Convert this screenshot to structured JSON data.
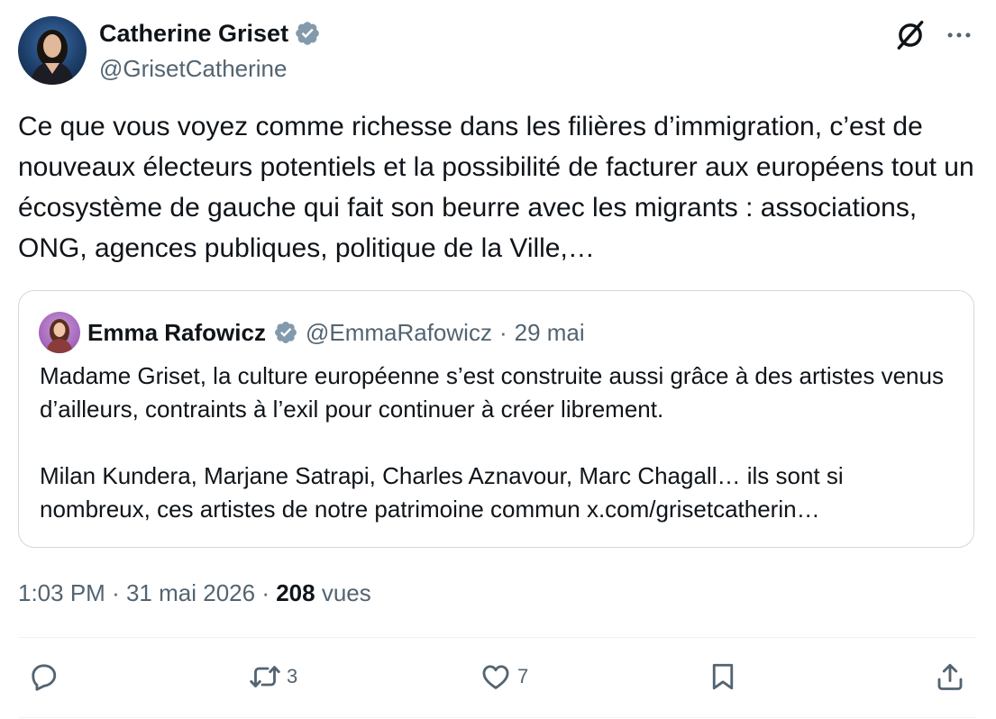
{
  "tweet": {
    "author": {
      "name": "Catherine Griset",
      "handle": "@GrisetCatherine"
    },
    "text": "Ce que vous voyez comme richesse dans les filières d’immigration, c’est de nouveaux électeurs potentiels et la possibilité de facturer aux européens tout un écosystème de gauche qui fait son beurre avec les migrants : associations, ONG, agences publiques, politique de la Ville,…",
    "quote": {
      "author": {
        "name": "Emma Rafowicz",
        "handle": "@EmmaRafowicz"
      },
      "separator": "·",
      "date": "29 mai",
      "paragraphs": [
        "Madame Griset, la culture européenne s’est construite aussi grâce à des artistes venus d’ailleurs, contraints à l’exil pour continuer à créer librement.",
        "Milan Kundera, Marjane Satrapi, Charles Aznavour, Marc Chagall… ils sont si nombreux, ces artistes de notre patrimoine commun x.com/grisetcatherin…"
      ]
    },
    "meta": {
      "time": "1:03 PM",
      "separator": "·",
      "date": "31 mai 2026",
      "views_count": "208",
      "views_label": "vues"
    },
    "actions": {
      "retweets": "3",
      "likes": "7"
    }
  },
  "icons": {
    "verified": "verified-badge-icon",
    "grok": "grok-icon",
    "more": "more-icon",
    "reply": "reply-icon",
    "retweet": "retweet-icon",
    "like": "heart-icon",
    "bookmark": "bookmark-icon",
    "share": "share-icon"
  },
  "colors": {
    "text": "#0f1419",
    "secondary": "#536471",
    "verified": "#829aab",
    "border": "#cfd9de"
  }
}
